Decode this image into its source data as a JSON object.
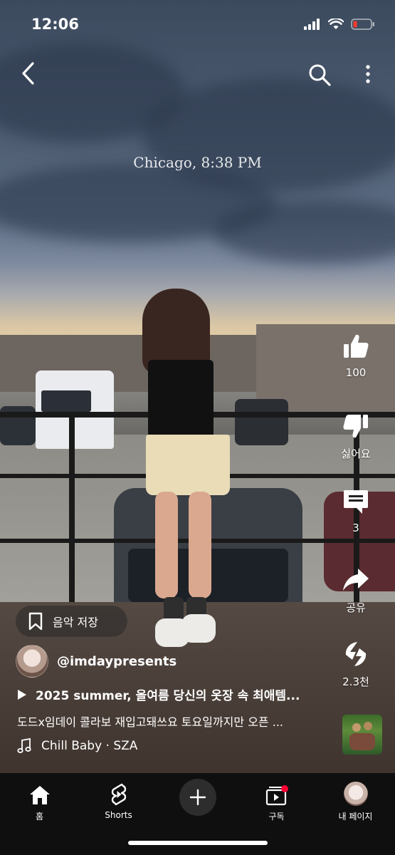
{
  "status_bar": {
    "time": "12:06"
  },
  "video": {
    "overlay_text": "Chicago, 8:38 PM"
  },
  "actions": {
    "like_count": "100",
    "dislike_label": "싫어요",
    "comment_count": "3",
    "share_label": "공유",
    "remix_count": "2.3천"
  },
  "save_music": {
    "label": "음악 저장"
  },
  "channel": {
    "handle": "@imdaypresents"
  },
  "video_title": "2025 summer, 올여름 당신의 옷장 속 최애템...",
  "description": "도드x임데이 콜라보 재입고돼쓰요 토요일까지만 오픈 ...",
  "music": {
    "track": "Chill Baby · SZA"
  },
  "nav": {
    "home": "홈",
    "shorts": "Shorts",
    "subscriptions": "구독",
    "my_page": "내 페이지"
  }
}
